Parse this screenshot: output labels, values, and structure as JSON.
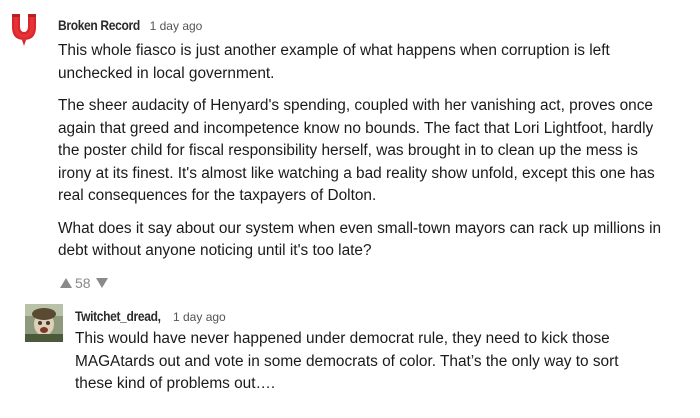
{
  "comments": [
    {
      "author": "Broken Record",
      "time": "1 day ago",
      "avatar_icon": "red-magnet-icon",
      "paragraphs": [
        "This whole fiasco is just another example of what happens when corruption is left unchecked in local government.",
        "The sheer audacity of Henyard's spending, coupled with her vanishing act, proves once again that greed and incompetence know no bounds. The fact that Lori Lightfoot, hardly the poster child for fiscal responsibility herself, was brought in to clean up the mess is irony at its finest. It's almost like watching a bad reality show unfold, except this one has real consequences for the taxpayers of Dolton.",
        "What does it say about our system when even small-town mayors can rack up millions in debt without anyone noticing until it's too late?"
      ],
      "votes": "58"
    },
    {
      "author": "Twitchet_dread,",
      "time": "1 day ago",
      "avatar_icon": "user-photo-avatar",
      "paragraphs": [
        "This would have never happened under democrat rule, they need to kick those MAGAtards out and vote in some democrats of color. That’s the only way to sort these kind of problems out…."
      ]
    }
  ],
  "colors": {
    "text": "#1a1a1a",
    "username": "#2b2b2b",
    "muted": "#888888",
    "avatar_red": "#d9262c"
  }
}
